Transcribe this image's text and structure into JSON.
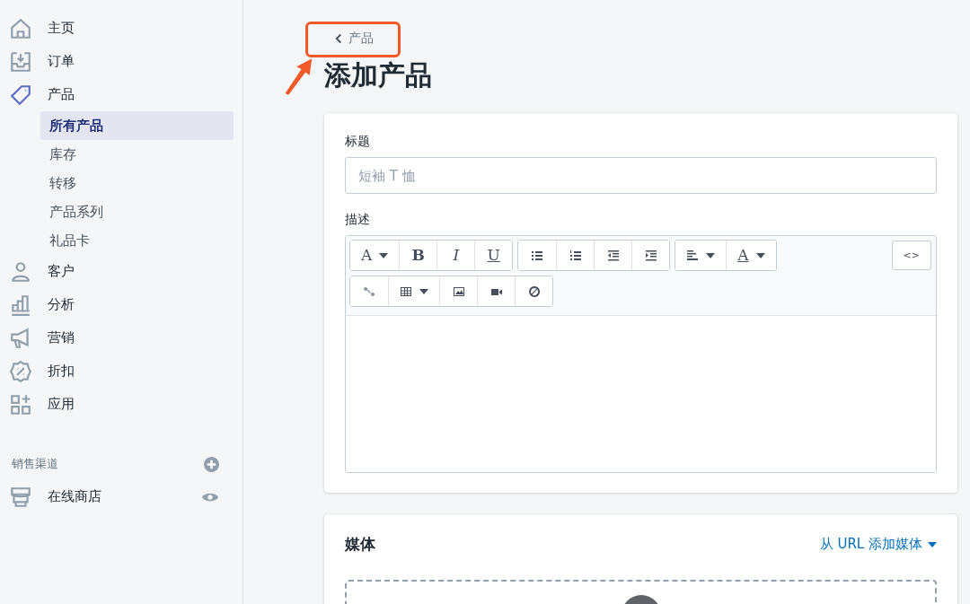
{
  "sidebar": {
    "items": [
      {
        "label": "主页",
        "selected": false
      },
      {
        "label": "订单",
        "selected": false
      },
      {
        "label": "产品",
        "selected": true,
        "children": [
          {
            "label": "所有产品",
            "selected": true
          },
          {
            "label": "库存",
            "selected": false
          },
          {
            "label": "转移",
            "selected": false
          },
          {
            "label": "产品系列",
            "selected": false
          },
          {
            "label": "礼品卡",
            "selected": false
          }
        ]
      },
      {
        "label": "客户",
        "selected": false
      },
      {
        "label": "分析",
        "selected": false
      },
      {
        "label": "营销",
        "selected": false
      },
      {
        "label": "折扣",
        "selected": false
      },
      {
        "label": "应用",
        "selected": false
      }
    ],
    "channels_heading": "销售渠道",
    "channels": [
      {
        "label": "在线商店"
      }
    ]
  },
  "back_link": "产品",
  "page_title": "添加产品",
  "product_card": {
    "title_label": "标题",
    "title_placeholder": "短袖 T 恤",
    "description_label": "描述",
    "toolbar": [
      [
        [
          {
            "kind": "text",
            "label": "A",
            "dropdown": true
          },
          {
            "kind": "bold",
            "label": "B",
            "dropdown": false
          },
          {
            "kind": "italic",
            "label": "I",
            "dropdown": false
          },
          {
            "kind": "underline",
            "label": "U",
            "dropdown": false
          }
        ],
        [
          {
            "kind": "bullets",
            "dropdown": false
          },
          {
            "kind": "numbers",
            "dropdown": false
          },
          {
            "kind": "outdent",
            "dropdown": false
          },
          {
            "kind": "indent",
            "dropdown": false
          }
        ],
        [
          {
            "kind": "align",
            "dropdown": true
          },
          {
            "kind": "color",
            "label": "A",
            "dropdown": true
          }
        ]
      ],
      [
        [
          {
            "kind": "link",
            "dropdown": false
          },
          {
            "kind": "table",
            "dropdown": true
          },
          {
            "kind": "image",
            "dropdown": false
          },
          {
            "kind": "video",
            "dropdown": false
          },
          {
            "kind": "clear",
            "dropdown": false
          }
        ]
      ]
    ],
    "html_button": "<>"
  },
  "media_card": {
    "title": "媒体",
    "url_link": "从 URL 添加媒体"
  }
}
